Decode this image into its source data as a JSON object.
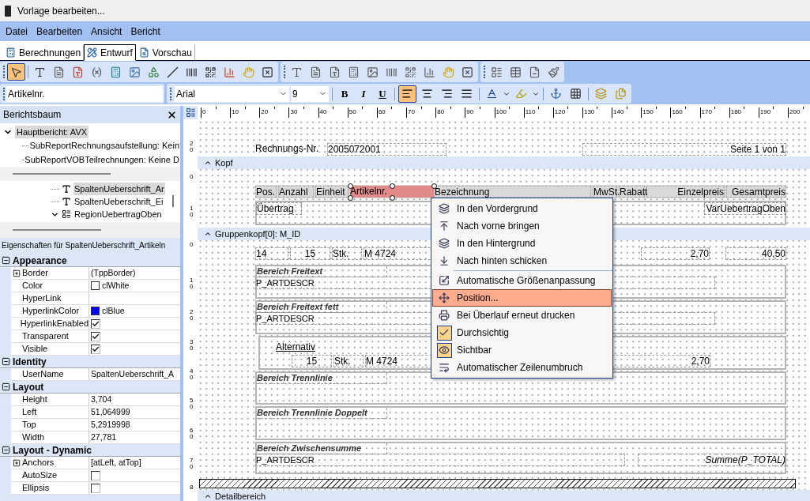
{
  "window": {
    "title": "Vorlage bearbeiten..."
  },
  "menu": [
    "Datei",
    "Bearbeiten",
    "Ansicht",
    "Bericht"
  ],
  "tabs": [
    {
      "label": "Berechnungen",
      "selected": false
    },
    {
      "label": "Entwurf",
      "selected": true
    },
    {
      "label": "Vorschau",
      "selected": false
    }
  ],
  "component_toolbar": [
    {
      "selected": true
    },
    {
      "selected": false
    },
    {
      "selected": false
    },
    {
      "selected": false
    },
    {
      "selected": false
    },
    {
      "selected": false
    },
    {
      "selected": false
    },
    {
      "selected": false
    },
    {
      "selected": false
    },
    {
      "selected": false
    },
    {
      "selected": false
    },
    {
      "selected": false
    },
    {
      "selected": false
    },
    {
      "selected": false
    }
  ],
  "format_bar": {
    "field": "Artikelnr.",
    "font": "Arial",
    "size": "9",
    "style_buttons": [
      {
        "label": "B",
        "selected": false
      },
      {
        "label": "I",
        "selected": false
      },
      {
        "label": "U",
        "selected": false
      }
    ],
    "align": [
      {
        "selected": true
      },
      {
        "selected": false
      },
      {
        "selected": false
      },
      {
        "selected": false
      }
    ]
  },
  "report_tree": {
    "title": "Berichtsbaum",
    "items": [
      {
        "label": "Hauptbericht: AVX",
        "selected": true,
        "expanded": true,
        "children": [
          {
            "label": "SubReportRechnungsaufstellung: Kein",
            "selected": false
          },
          {
            "label": "SubReportVOBTeilrechnungen: Keine D",
            "selected": false
          }
        ]
      }
    ]
  },
  "component_tree": [
    {
      "label": "SpaltenUeberschrift_Ar",
      "kind": "text",
      "selected": true
    },
    {
      "label": "SpaltenUeberschrift_Ei",
      "kind": "text",
      "selected": false
    },
    {
      "label": "RegionUebertragOben",
      "kind": "region",
      "selected": false,
      "expanded": true
    }
  ],
  "properties": {
    "title": "Eigenschaften für SpaltenUeberschrift_Artikeln",
    "categories": [
      {
        "name": "Appearance",
        "expanded": true,
        "rows": [
          {
            "name": "Border",
            "kind": "expandable",
            "value": "(TppBorder)"
          },
          {
            "name": "Color",
            "kind": "color",
            "value": "clWhite",
            "color": "#ffffff"
          },
          {
            "name": "HyperLink",
            "kind": "text"
          },
          {
            "name": "HyperlinkColor",
            "kind": "color",
            "value": "clBlue",
            "color": "#0000ff"
          },
          {
            "name": "HyperlinkEnabled",
            "kind": "check",
            "checked": true
          },
          {
            "name": "Transparent",
            "kind": "check",
            "checked": true
          },
          {
            "name": "Visible",
            "kind": "check",
            "checked": true
          }
        ]
      },
      {
        "name": "Identity",
        "expanded": true,
        "rows": [
          {
            "name": "UserName",
            "kind": "text",
            "value": "SpaltenUeberschrift_A"
          }
        ]
      },
      {
        "name": "Layout",
        "expanded": true,
        "rows": [
          {
            "name": "Height",
            "kind": "text",
            "value": "3,704"
          },
          {
            "name": "Left",
            "kind": "text",
            "value": "51,064999"
          },
          {
            "name": "Top",
            "kind": "text",
            "value": "5,2919998"
          },
          {
            "name": "Width",
            "kind": "text",
            "value": "27,781"
          }
        ]
      },
      {
        "name": "Layout - Dynamic",
        "expanded": true,
        "rows": [
          {
            "name": "Anchors",
            "kind": "expandable",
            "value": "[atLeft, atTop]"
          },
          {
            "name": "AutoSize",
            "kind": "check",
            "checked": false
          },
          {
            "name": "Ellipsis",
            "kind": "check",
            "checked": false
          }
        ]
      }
    ]
  },
  "ruler": {
    "horizontal": [
      "0",
      "10",
      "20",
      "30",
      "40",
      "50",
      "60",
      "70",
      "80",
      "90",
      "100",
      "110",
      "120",
      "130",
      "140",
      "150",
      "160",
      "170",
      "180",
      "190",
      "200"
    ],
    "vertical": [
      "20",
      "0",
      "10",
      "0",
      "10",
      "20",
      "30",
      "40",
      "50",
      "60",
      "70",
      "8"
    ]
  },
  "canvas": {
    "title_band": [
      "Rechnungs-Nr.",
      "2005072001",
      "Seite 1 von 1"
    ],
    "bands": [
      {
        "label": "Kopf"
      },
      {
        "label": "Gruppenkopf[0]: M_ID"
      },
      {
        "label": "Detailbereich"
      }
    ],
    "column_headers": [
      {
        "label": "Pos.",
        "selected": false
      },
      {
        "label": "Anzahl",
        "selected": false
      },
      {
        "label": "Einheit",
        "selected": false
      },
      {
        "label": "Artikelnr.",
        "selected": true
      },
      {
        "label": "Bezeichnung",
        "selected": false
      },
      {
        "label": "MwSt.",
        "selected": false
      },
      {
        "label": "Rabatt",
        "selected": false
      },
      {
        "label": "Einzelpreis",
        "selected": false
      },
      {
        "label": "Gesamtpreis",
        "selected": false
      }
    ],
    "carry_row": [
      "Übertrag",
      "VarUebertragOben"
    ],
    "group_row": [
      "14",
      "15",
      "Stk.",
      "M 4724",
      "2,70",
      "40,50"
    ],
    "regions": [
      {
        "kind": "memo",
        "title": "Bereich Freitext",
        "field": "P_ARTDESCR"
      },
      {
        "kind": "memo",
        "title": "Bereich Freitext fett",
        "field": "P_ARTDESCR"
      },
      {
        "kind": "alternative",
        "title": "Alternativ",
        "cells": [
          "15",
          "Stk.",
          "M 4724",
          "2,70"
        ]
      },
      {
        "kind": "empty",
        "title": "Bereich Trennlinie"
      },
      {
        "kind": "empty",
        "title": "Bereich Trennlinie Doppelt"
      },
      {
        "kind": "total",
        "title": "Bereich Zwischensumme",
        "field": "P_ARTDESCR",
        "total": "Summe(P_TOTAL)"
      }
    ]
  },
  "context_menu": {
    "groups": [
      [
        {
          "label": "In den Vordergrund",
          "selected": false,
          "checked": false
        },
        {
          "label": "Nach vorne bringen",
          "selected": false,
          "checked": false
        },
        {
          "label": "In den Hintergrund",
          "selected": false,
          "checked": false
        },
        {
          "label": "Nach hinten schicken",
          "selected": false,
          "checked": false
        }
      ],
      [
        {
          "label": "Automatische Größenanpassung",
          "selected": false,
          "checked": false
        },
        {
          "label": "Position...",
          "selected": true,
          "checked": false
        },
        {
          "label": "Bei Überlauf erneut drucken",
          "selected": false,
          "checked": false
        },
        {
          "label": "Durchsichtig",
          "selected": false,
          "checked": true
        },
        {
          "label": "Sichtbar",
          "selected": false,
          "checked": true
        },
        {
          "label": "Automatischer Zeilenumbruch",
          "selected": false,
          "checked": false
        }
      ]
    ]
  }
}
